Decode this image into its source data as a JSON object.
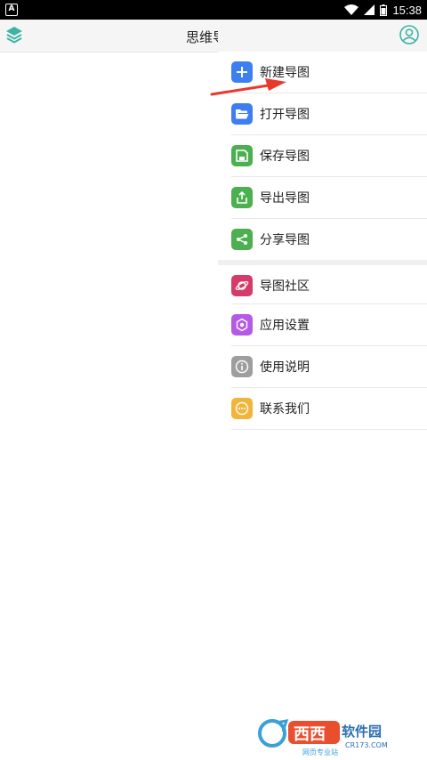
{
  "status_bar": {
    "time": "15:38",
    "left_icon": "A"
  },
  "app_bar": {
    "title": "思维导图",
    "layers_icon": "layers-icon",
    "user_icon": "user-circle-icon"
  },
  "drawer": {
    "items": [
      {
        "label": "新建导图",
        "icon": "plus-icon",
        "color": "#3d7ef0"
      },
      {
        "label": "打开导图",
        "icon": "folder-open-icon",
        "color": "#3d7ef0"
      },
      {
        "label": "保存导图",
        "icon": "save-icon",
        "color": "#4caf50"
      },
      {
        "label": "导出导图",
        "icon": "export-icon",
        "color": "#4caf50"
      },
      {
        "label": "分享导图",
        "icon": "share-icon",
        "color": "#4caf50"
      },
      {
        "label": "导图社区",
        "icon": "planet-icon",
        "color": "#d63a68"
      },
      {
        "label": "应用设置",
        "icon": "settings-hex-icon",
        "color": "#b45ae6"
      },
      {
        "label": "使用说明",
        "icon": "info-icon",
        "color": "#9e9e9e"
      },
      {
        "label": "联系我们",
        "icon": "chat-icon",
        "color": "#f2b53b"
      }
    ]
  },
  "annotation": {
    "arrow_color": "#e8392b"
  },
  "watermark": {
    "brand": "西西软件园",
    "domain": "CR173.COM",
    "tagline": "网页专业站"
  }
}
